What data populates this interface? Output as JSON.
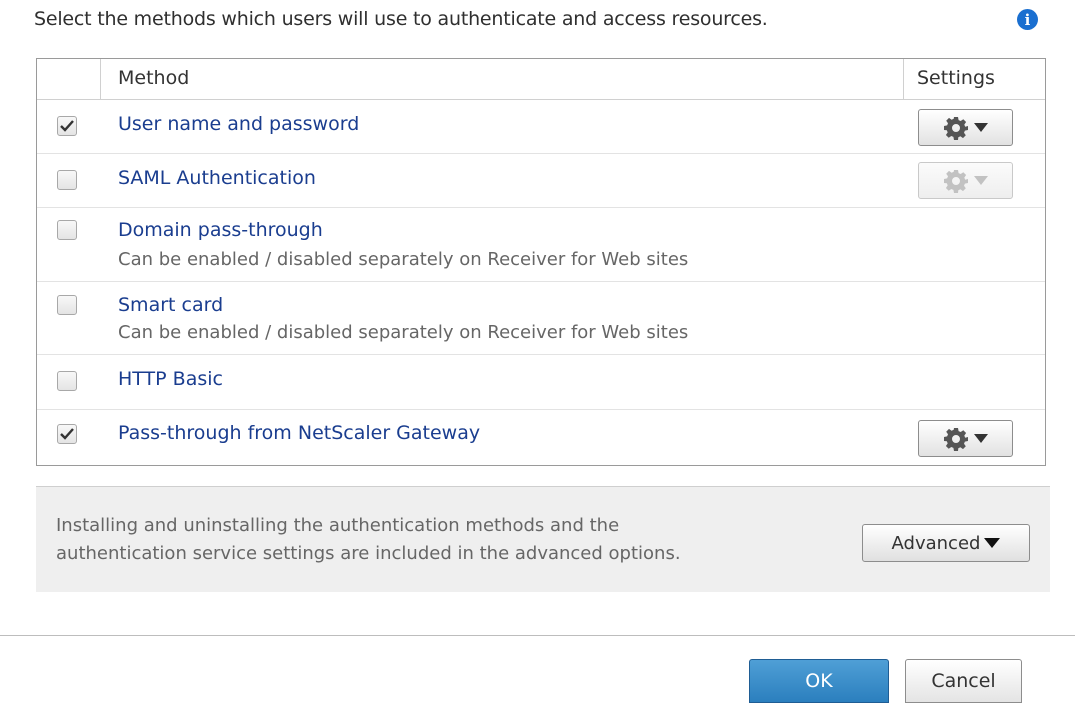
{
  "intro_text": "Select the methods which users will use to authenticate and access resources.",
  "info_icon": "info-icon",
  "table": {
    "col_method": "Method",
    "col_settings": "Settings",
    "rows": [
      {
        "label": "User name and password",
        "sublabel": "",
        "checked": true,
        "settings": "enabled"
      },
      {
        "label": "SAML Authentication",
        "sublabel": "",
        "checked": false,
        "settings": "disabled"
      },
      {
        "label": "Domain pass-through",
        "sublabel": "Can be enabled / disabled separately on Receiver for Web sites",
        "checked": false,
        "settings": "none"
      },
      {
        "label": "Smart card",
        "sublabel": "Can be enabled / disabled separately on Receiver for Web sites",
        "checked": false,
        "settings": "none"
      },
      {
        "label": "HTTP Basic",
        "sublabel": "",
        "checked": false,
        "settings": "none"
      },
      {
        "label": "Pass-through from NetScaler Gateway",
        "sublabel": "",
        "checked": true,
        "settings": "enabled"
      }
    ]
  },
  "advanced": {
    "text_line1": "Installing and uninstalling the authentication methods and the",
    "text_line2": "authentication service settings are included in the advanced options.",
    "button_label": "Advanced"
  },
  "footer": {
    "ok_label": "OK",
    "cancel_label": "Cancel"
  },
  "colors": {
    "accent": "#2b7fbe",
    "link": "#1a3d8f",
    "info": "#1a6fd0"
  }
}
